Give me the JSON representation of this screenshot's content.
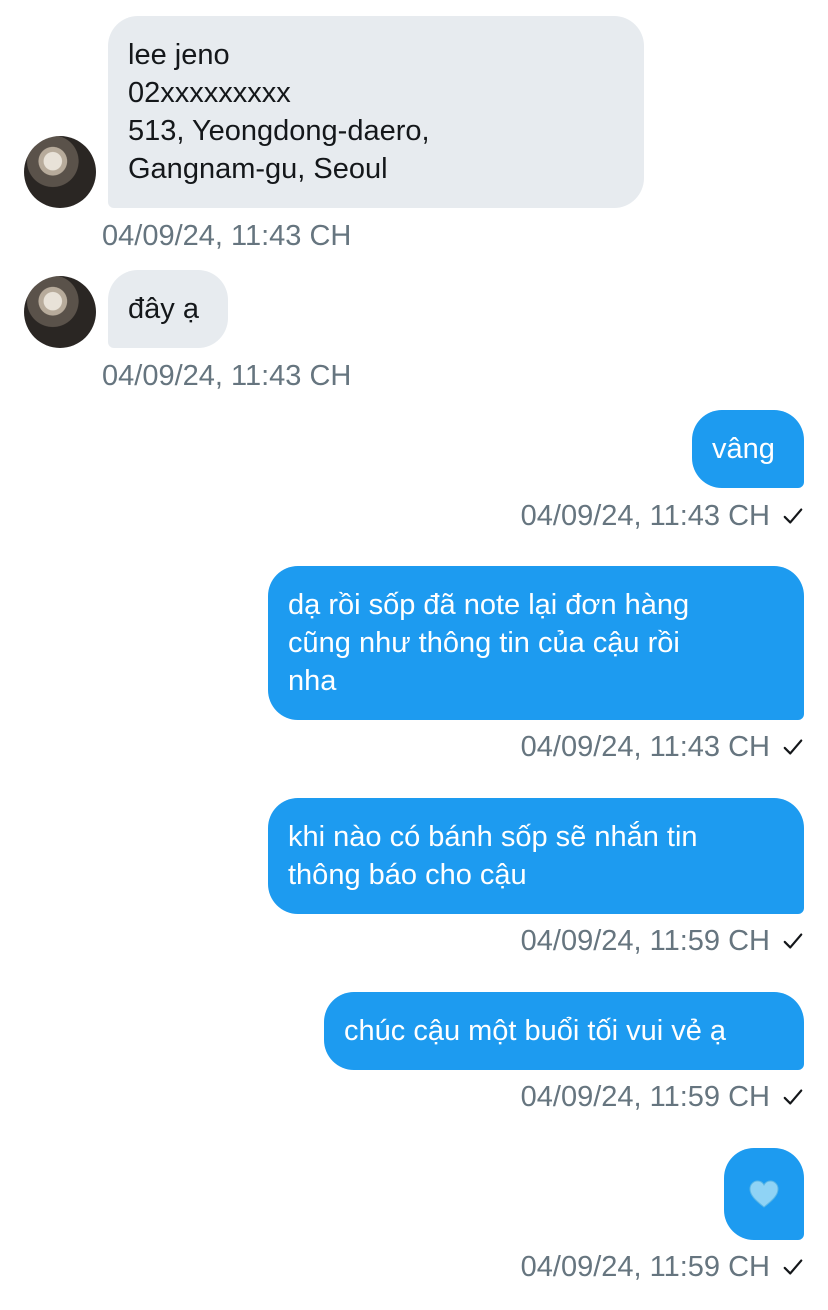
{
  "colors": {
    "incoming_bubble": "#e7ebef",
    "outgoing_bubble": "#1d9bf0",
    "timestamp": "#66757f"
  },
  "messages": [
    {
      "direction": "incoming",
      "text": "lee jeno\n02xxxxxxxxx\n513, Yeongdong-daero,\nGangnam-gu, Seoul",
      "time": "04/09/24, 11:43 CH",
      "avatar_icon": "user-avatar"
    },
    {
      "direction": "incoming",
      "text": "đây ạ",
      "time": "04/09/24, 11:43 CH",
      "avatar_icon": "user-avatar"
    },
    {
      "direction": "outgoing",
      "text": "vâng",
      "time": "04/09/24, 11:43 CH",
      "status_icon": "check-icon"
    },
    {
      "direction": "outgoing",
      "text": "dạ rồi sốp đã note lại đơn hàng\ncũng như thông tin của cậu rồi\nnha",
      "time": "04/09/24, 11:43 CH",
      "status_icon": "check-icon"
    },
    {
      "direction": "outgoing",
      "text": "khi nào có bánh sốp sẽ nhắn tin\nthông báo cho cậu",
      "time": "04/09/24, 11:59 CH",
      "status_icon": "check-icon"
    },
    {
      "direction": "outgoing",
      "text": "chúc cậu một buổi tối vui vẻ ạ",
      "time": "04/09/24, 11:59 CH",
      "status_icon": "check-icon"
    },
    {
      "direction": "outgoing",
      "emoji_icon": "light-blue-heart-icon",
      "time": "04/09/24, 11:59 CH",
      "status_icon": "check-icon"
    }
  ]
}
